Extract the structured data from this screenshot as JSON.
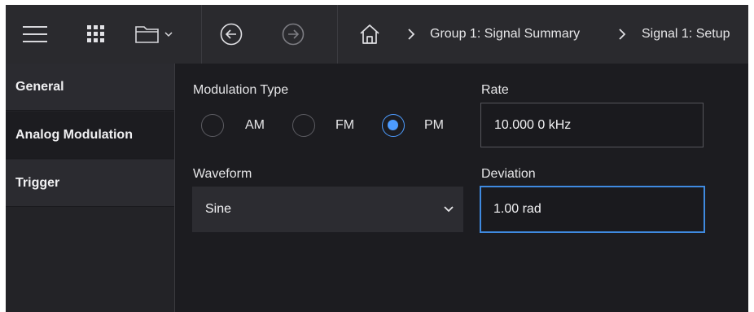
{
  "toolbar": {
    "icons": [
      "menu-icon",
      "grid-apps-icon",
      "folder-icon",
      "chevron-down-icon",
      "back-arrow-icon",
      "forward-arrow-icon",
      "home-icon"
    ],
    "breadcrumb": [
      "Group 1: Signal Summary",
      "Signal 1: Setup"
    ]
  },
  "sidebar": {
    "items": [
      {
        "label": "General",
        "active": false
      },
      {
        "label": "Analog Modulation",
        "active": true
      },
      {
        "label": "Trigger",
        "active": false
      }
    ]
  },
  "modulation": {
    "label": "Modulation Type",
    "options": [
      "AM",
      "FM",
      "PM"
    ],
    "selected": "PM"
  },
  "rate": {
    "label": "Rate",
    "value": "10.000 0 kHz"
  },
  "waveform": {
    "label": "Waveform",
    "value": "Sine"
  },
  "deviation": {
    "label": "Deviation",
    "value": "1.00 rad"
  },
  "colors": {
    "accent": "#4d9cff",
    "background": "#1c1c20",
    "toolbar": "#2a2a2e"
  }
}
